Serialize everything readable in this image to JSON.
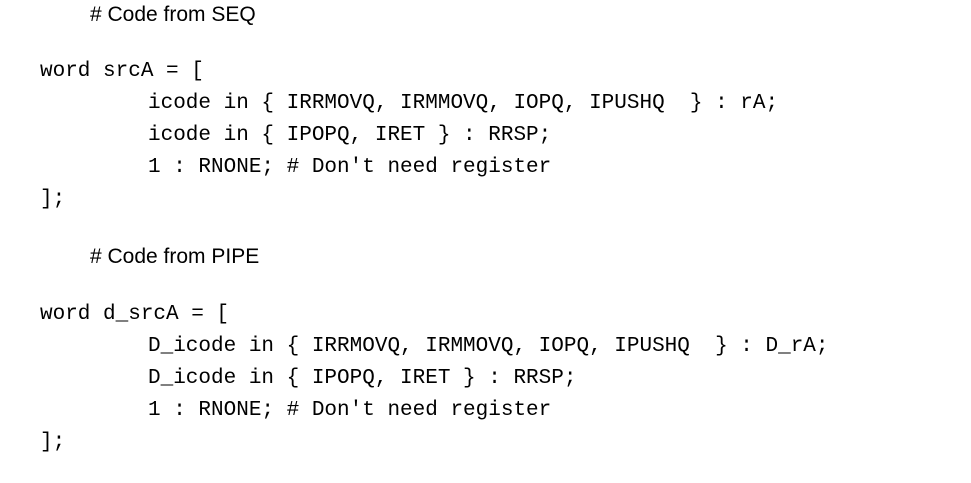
{
  "document": {
    "blocks": [
      {
        "heading": "# Code from SEQ",
        "declaration": "word srcA = [",
        "cases": [
          "icode in { IRRMOVQ, IRMMOVQ, IOPQ, IPUSHQ  } : rA;",
          "icode in { IPOPQ, IRET } : RRSP;",
          "1 : RNONE; # Don't need register"
        ],
        "closing": "];"
      },
      {
        "heading": "# Code from PIPE",
        "declaration": "word d_srcA = [",
        "cases": [
          "D_icode in { IRRMOVQ, IRMMOVQ, IOPQ, IPUSHQ  } : D_rA;",
          "D_icode in { IPOPQ, IRET } : RRSP;",
          "1 : RNONE; # Don't need register"
        ],
        "closing": "];"
      }
    ]
  }
}
